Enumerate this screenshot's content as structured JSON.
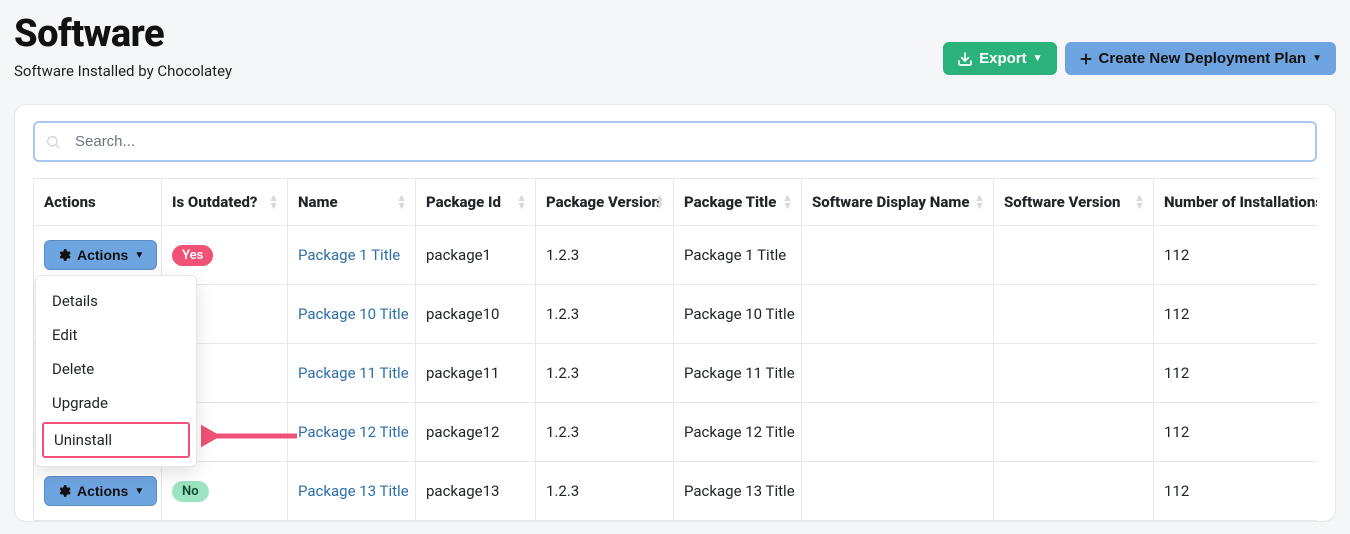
{
  "header": {
    "title": "Software",
    "subtitle": "Software Installed by Chocolatey",
    "export_label": "Export",
    "create_plan_label": "Create New Deployment Plan"
  },
  "search": {
    "placeholder": "Search..."
  },
  "columns": {
    "actions": "Actions",
    "outdated": "Is Outdated?",
    "name": "Name",
    "package_id": "Package Id",
    "package_version": "Package Version",
    "package_title": "Package Title",
    "software_display_name": "Software Display Name",
    "software_version": "Software Version",
    "installations": "Number of Installations"
  },
  "actions_button_label": "Actions",
  "dropdown": {
    "details": "Details",
    "edit": "Edit",
    "delete": "Delete",
    "upgrade": "Upgrade",
    "uninstall": "Uninstall"
  },
  "badges": {
    "yes": "Yes",
    "no": "No"
  },
  "rows": [
    {
      "outdated": "Yes",
      "name": "Package 1 Title",
      "package_id": "package1",
      "version": "1.2.3",
      "title": "Package 1 Title",
      "display_name": "",
      "software_version": "",
      "installations": "112"
    },
    {
      "outdated": "",
      "name": "Package 10 Title",
      "package_id": "package10",
      "version": "1.2.3",
      "title": "Package 10 Title",
      "display_name": "",
      "software_version": "",
      "installations": "112"
    },
    {
      "outdated": "",
      "name": "Package 11 Title",
      "package_id": "package11",
      "version": "1.2.3",
      "title": "Package 11 Title",
      "display_name": "",
      "software_version": "",
      "installations": "112"
    },
    {
      "outdated": "",
      "name": "Package 12 Title",
      "package_id": "package12",
      "version": "1.2.3",
      "title": "Package 12 Title",
      "display_name": "",
      "software_version": "",
      "installations": "112"
    },
    {
      "outdated": "No",
      "name": "Package 13 Title",
      "package_id": "package13",
      "version": "1.2.3",
      "title": "Package 13 Title",
      "display_name": "",
      "software_version": "",
      "installations": "112"
    }
  ]
}
